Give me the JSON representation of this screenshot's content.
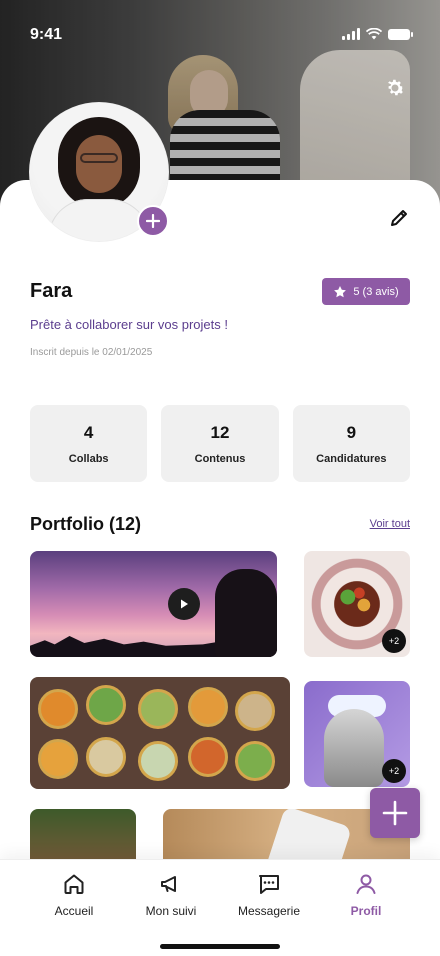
{
  "status_bar": {
    "time": "9:41"
  },
  "profile": {
    "name": "Fara",
    "rating": "5 (3 avis)",
    "tagline": "Prête à collaborer sur vos projets !",
    "joined": "Inscrit depuis le 02/01/2025"
  },
  "stats": [
    {
      "value": "4",
      "label": "Collabs"
    },
    {
      "value": "12",
      "label": "Contenus"
    },
    {
      "value": "9",
      "label": "Candidatures"
    }
  ],
  "portfolio": {
    "title": "Portfolio (12)",
    "see_all": "Voir tout",
    "badges": {
      "dish": "+2",
      "art": "+2"
    }
  },
  "nav": {
    "items": [
      {
        "label": "Accueil",
        "icon": "home-icon"
      },
      {
        "label": "Mon suivi",
        "icon": "megaphone-icon"
      },
      {
        "label": "Messagerie",
        "icon": "message-icon"
      },
      {
        "label": "Profil",
        "icon": "user-icon"
      }
    ],
    "active": "Profil"
  },
  "colors": {
    "accent": "#8e5aa5",
    "accent_text": "#5b3d8e",
    "card_bg": "#f0f0f0"
  }
}
